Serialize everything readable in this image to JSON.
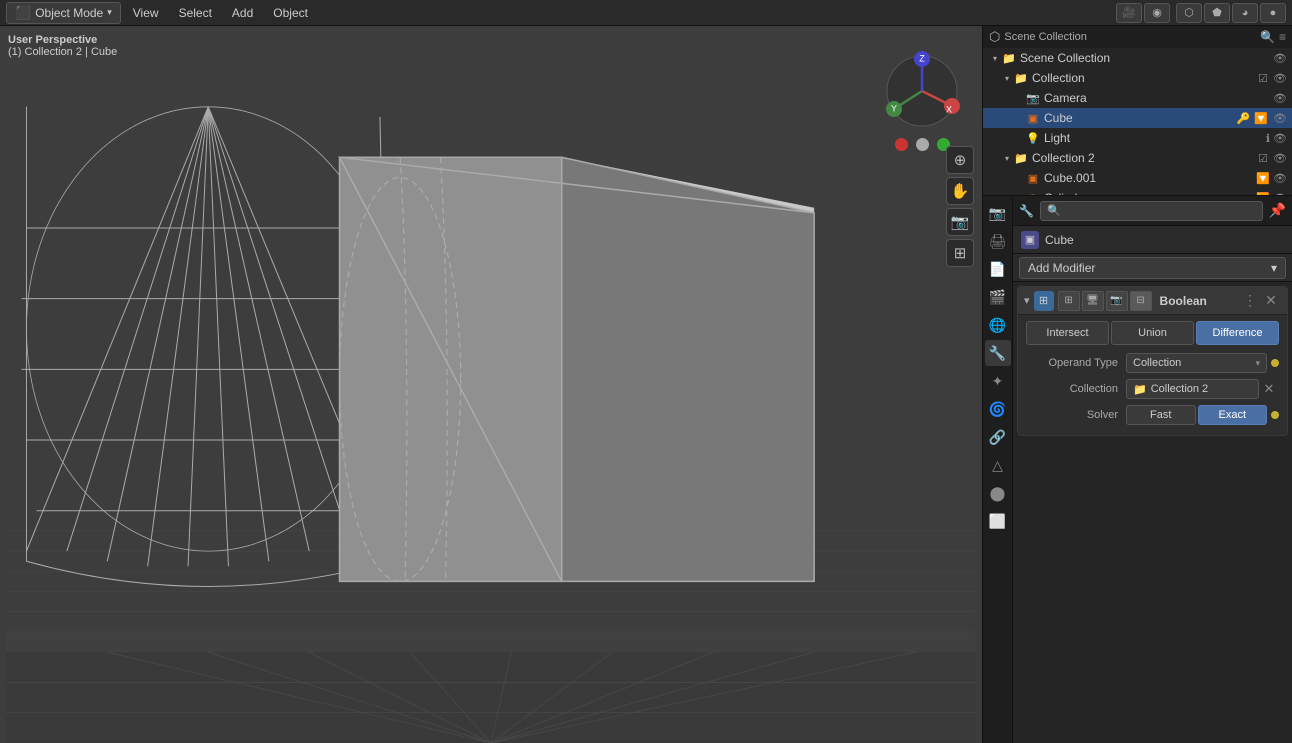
{
  "topbar": {
    "mode_label": "Object Mode",
    "menu_items": [
      "View",
      "Select",
      "Add",
      "Object"
    ],
    "mode_dropdown": "▾"
  },
  "viewport": {
    "overlay_line1": "User Perspective",
    "overlay_line2": "(1) Collection 2 | Cube",
    "gizmo_x": "X",
    "gizmo_y": "Y",
    "gizmo_z": "Z",
    "dot_colors": [
      "#cc3333",
      "#aaaaaa",
      "#33aa33"
    ],
    "bg_color": "#3d3d3d"
  },
  "outliner": {
    "title": "Scene Collection",
    "items": [
      {
        "label": "Collection",
        "level": 1,
        "expanded": true,
        "type": "collection",
        "has_check": true
      },
      {
        "label": "Camera",
        "level": 2,
        "type": "camera"
      },
      {
        "label": "Cube",
        "level": 2,
        "type": "mesh",
        "selected": true
      },
      {
        "label": "Light",
        "level": 2,
        "type": "light"
      },
      {
        "label": "Collection 2",
        "level": 1,
        "expanded": true,
        "type": "collection",
        "has_check": true
      },
      {
        "label": "Cube.001",
        "level": 2,
        "type": "mesh"
      },
      {
        "label": "Cylinder",
        "level": 2,
        "type": "mesh"
      }
    ]
  },
  "properties": {
    "search_placeholder": "🔍",
    "object_name": "Cube",
    "object_icon": "▣",
    "add_modifier_label": "Add Modifier",
    "modifier": {
      "name": "Boolean",
      "icon": "⊞",
      "operations": [
        "Intersect",
        "Union",
        "Difference"
      ],
      "active_operation": "Difference",
      "operand_type_label": "Operand Type",
      "operand_type_value": "Collection",
      "collection_label": "Collection",
      "collection_value": "Collection 2",
      "solver_label": "Solver",
      "solver_options": [
        "Fast",
        "Exact"
      ],
      "active_solver": "Exact"
    }
  },
  "icons": {
    "cursor": "🖱",
    "hand": "✋",
    "camera_icon": "📷",
    "light_icon": "💡",
    "mesh_icon": "△",
    "collection_icon": "📁",
    "eye_icon": "👁",
    "search_icon": "🔍",
    "pin_icon": "📌",
    "wrench_icon": "🔧",
    "chevron_down": "▾",
    "chevron_right": "▸",
    "close": "✕",
    "dots": "⋮"
  }
}
